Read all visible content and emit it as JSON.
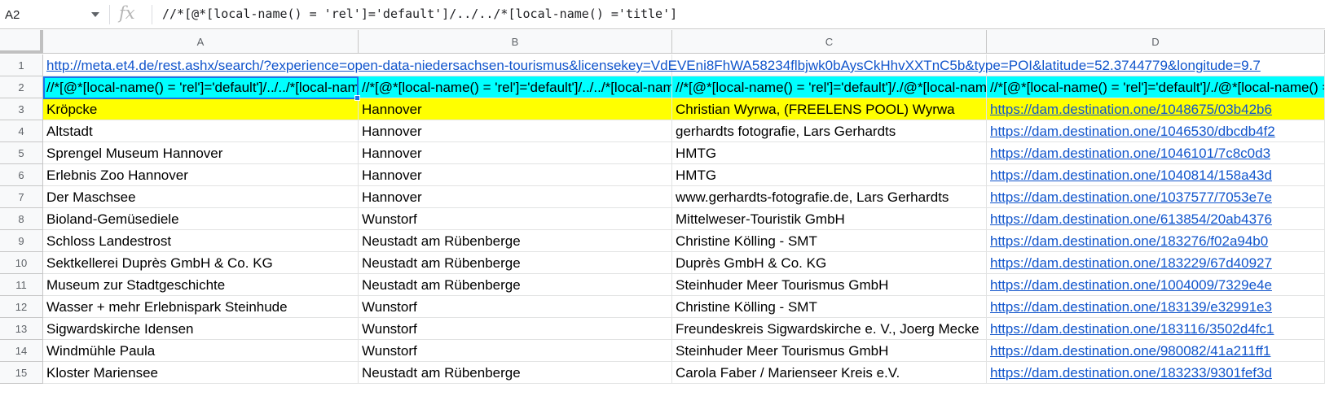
{
  "formula_bar": {
    "name_box": "A2",
    "fx": "fx",
    "formula": "//*[@*[local-name() = 'rel']='default']/../../*[local-name() ='title']"
  },
  "columns": [
    "A",
    "B",
    "C",
    "D"
  ],
  "rows": [
    {
      "num": "1",
      "cells": [
        "http://meta.et4.de/rest.ashx/search/?experience=open-data-niedersachsen-tourismus&licensekey=VdEVEni8FhWA58234flbjwk0bAysCkHhvXXTnC5b&type=POI&latitude=52.3744779&longitude=9.7",
        "",
        "",
        ""
      ]
    },
    {
      "num": "2",
      "cells": [
        "//*[@*[local-name() = 'rel']='default']/../../*[local-name() ='title']",
        "//*[@*[local-name() = 'rel']='default']/../../*[local-name() ='title']",
        "//*[@*[local-name() = 'rel']='default']/./@*[local-name() ='title']",
        "//*[@*[local-name() = 'rel']='default']/./@*[local-name() ='title']"
      ]
    },
    {
      "num": "3",
      "cells": [
        "Kröpcke",
        "Hannover",
        "Christian Wyrwa, (FREELENS POOL) Wyrwa",
        "https://dam.destination.one/1048675/03b42b6"
      ]
    },
    {
      "num": "4",
      "cells": [
        "Altstadt",
        "Hannover",
        "gerhardts fotografie, Lars Gerhardts",
        "https://dam.destination.one/1046530/dbcdb4f2"
      ]
    },
    {
      "num": "5",
      "cells": [
        "Sprengel Museum Hannover",
        "Hannover",
        "HMTG",
        "https://dam.destination.one/1046101/7c8c0d3"
      ]
    },
    {
      "num": "6",
      "cells": [
        "Erlebnis Zoo Hannover",
        "Hannover",
        "HMTG",
        "https://dam.destination.one/1040814/158a43d"
      ]
    },
    {
      "num": "7",
      "cells": [
        "Der Maschsee",
        "Hannover",
        "www.gerhardts-fotografie.de, Lars Gerhardts",
        "https://dam.destination.one/1037577/7053e7e"
      ]
    },
    {
      "num": "8",
      "cells": [
        "Bioland-Gemüsediele",
        "Wunstorf",
        "Mittelweser-Touristik GmbH",
        "https://dam.destination.one/613854/20ab4376"
      ]
    },
    {
      "num": "9",
      "cells": [
        "Schloss Landestrost",
        "Neustadt am Rübenberge",
        "Christine Kölling - SMT",
        "https://dam.destination.one/183276/f02a94b0"
      ]
    },
    {
      "num": "10",
      "cells": [
        "Sektkellerei Duprès GmbH & Co. KG",
        "Neustadt am Rübenberge",
        "Duprès GmbH & Co. KG",
        "https://dam.destination.one/183229/67d40927"
      ]
    },
    {
      "num": "11",
      "cells": [
        "Museum zur Stadtgeschichte",
        "Neustadt am Rübenberge",
        "Steinhuder Meer Tourismus GmbH",
        "https://dam.destination.one/1004009/7329e4e"
      ]
    },
    {
      "num": "12",
      "cells": [
        "Wasser + mehr Erlebnispark Steinhude",
        "Wunstorf",
        "Christine Kölling - SMT",
        "https://dam.destination.one/183139/e32991e3"
      ]
    },
    {
      "num": "13",
      "cells": [
        "Sigwardskirche Idensen",
        "Wunstorf",
        "Freundeskreis Sigwardskirche e. V., Joerg Mecke",
        "https://dam.destination.one/183116/3502d4fc1"
      ]
    },
    {
      "num": "14",
      "cells": [
        "Windmühle Paula",
        "Wunstorf",
        "Steinhuder Meer Tourismus GmbH",
        "https://dam.destination.one/980082/41a211ff1"
      ]
    },
    {
      "num": "15",
      "cells": [
        "Kloster Mariensee",
        "Neustadt am Rübenberge",
        "Carola Faber / Marienseer Kreis e.V.",
        "https://dam.destination.one/183233/9301fef3d"
      ]
    }
  ],
  "colors": {
    "highlight_row2": "#00ffff",
    "highlight_row3": "#ffff00",
    "link": "#1155cc",
    "selection": "#1a73e8"
  }
}
